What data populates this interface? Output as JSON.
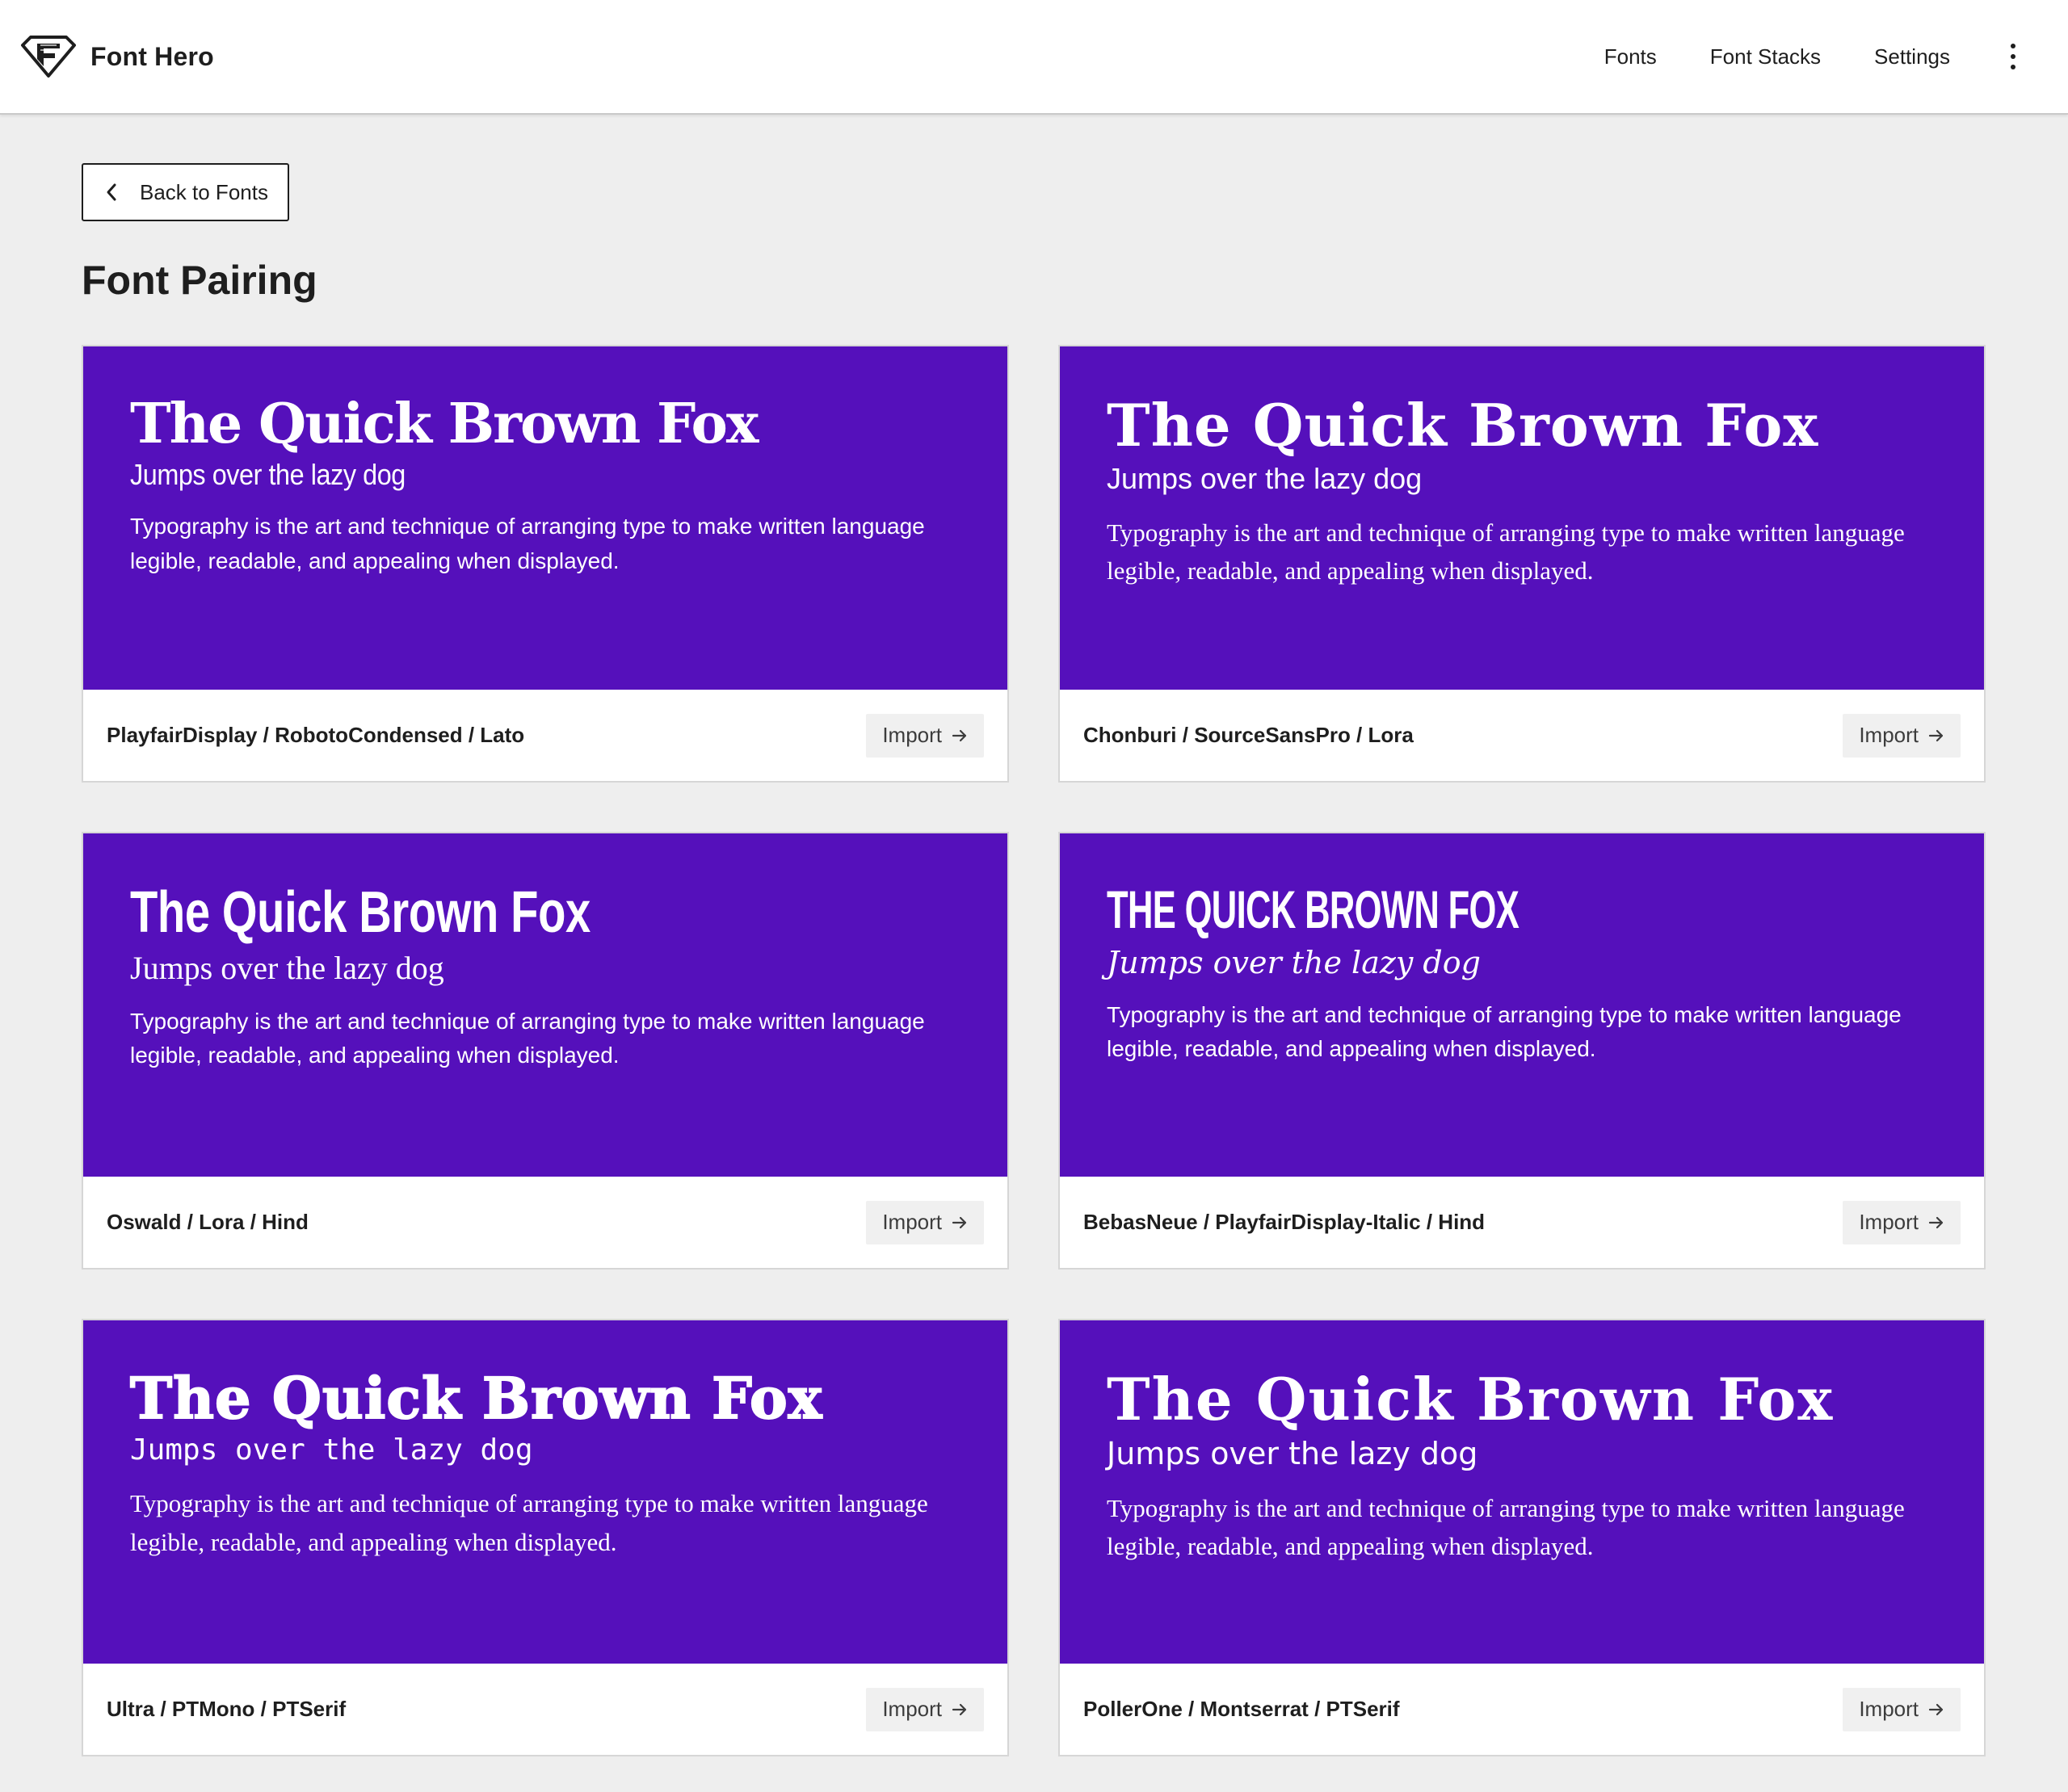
{
  "app": {
    "name": "Font Hero",
    "logo_icon": "font-hero-diamond-logo"
  },
  "nav": {
    "items": [
      "Fonts",
      "Font Stacks",
      "Settings"
    ],
    "more_icon": "vertical-ellipsis-icon"
  },
  "back_button": {
    "label": "Back to Fonts",
    "icon": "chevron-left-icon"
  },
  "page": {
    "title": "Font Pairing"
  },
  "colors": {
    "preview_background": "#5510bb",
    "preview_text": "#ffffff",
    "page_background": "#eeeeee",
    "import_button_background": "#f0f0f0"
  },
  "pairings": [
    {
      "heading": "The Quick Brown Fox",
      "subheading": "Jumps over the lazy dog",
      "body": "Typography is the art and technique of arranging type to make written language legible, readable, and appealing when displayed.",
      "name": "PlayfairDisplay / RobotoCondensed / Lato",
      "import_label": "Import"
    },
    {
      "heading": "The Quick Brown Fox",
      "subheading": "Jumps over the lazy dog",
      "body": "Typography is the art and technique of arranging type to make written language legible, readable, and appealing when displayed.",
      "name": "Chonburi / SourceSansPro / Lora",
      "import_label": "Import"
    },
    {
      "heading": "The Quick Brown Fox",
      "subheading": "Jumps over the lazy dog",
      "body": "Typography is the art and technique of arranging type to make written language legible, readable, and appealing when displayed.",
      "name": "Oswald / Lora / Hind",
      "import_label": "Import"
    },
    {
      "heading": "The Quick Brown Fox",
      "subheading": "Jumps over the lazy dog",
      "body": "Typography is the art and technique of arranging type to make written language legible, readable, and appealing when displayed.",
      "name": "BebasNeue / PlayfairDisplay-Italic / Hind",
      "import_label": "Import"
    },
    {
      "heading": "The Quick Brown Fox",
      "subheading": "Jumps over the lazy dog",
      "body": "Typography is the art and technique of arranging type to make written language legible, readable, and appealing when displayed.",
      "name": "Ultra / PTMono / PTSerif",
      "import_label": "Import"
    },
    {
      "heading": "The Quick Brown Fox",
      "subheading": "Jumps over the lazy dog",
      "body": "Typography is the art and technique of arranging type to make written language legible, readable, and appealing when displayed.",
      "name": "PollerOne / Montserrat / PTSerif",
      "import_label": "Import"
    }
  ]
}
